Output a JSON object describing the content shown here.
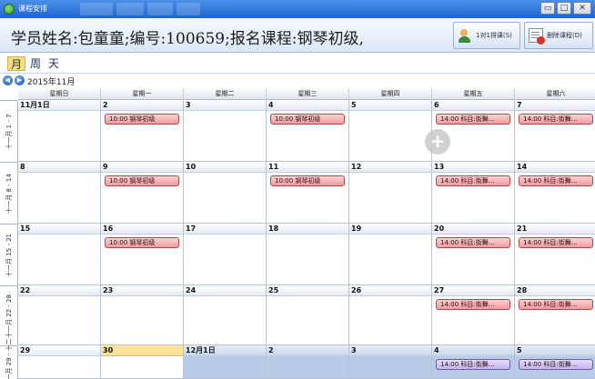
{
  "window": {
    "title": "课程安排",
    "minimize_glyph": "▭",
    "maximize_glyph": "□",
    "close_glyph": "✕"
  },
  "header": {
    "student_info": "学员姓名:包童童;编号:100659;报名课程:钢琴初级,",
    "schedule_button": "1对1排课(S)",
    "delete_button": "删除课程(D)"
  },
  "view_tabs": {
    "month": "月",
    "week": "周",
    "day": "天",
    "active": "month"
  },
  "nav": {
    "prev_glyph": "◀",
    "next_glyph": "▶",
    "current": "2015年11月"
  },
  "weekdays": [
    "星期日",
    "星期一",
    "星期二",
    "星期三",
    "星期四",
    "星期五",
    "星期六"
  ],
  "weeks": [
    {
      "label": "十一月 1 - 7",
      "days": [
        "11月1日",
        "2",
        "3",
        "4",
        "5",
        "6",
        "7"
      ]
    },
    {
      "label": "十一月 8 - 14",
      "days": [
        "8",
        "9",
        "10",
        "11",
        "12",
        "13",
        "14"
      ]
    },
    {
      "label": "十一月 15 - 21",
      "days": [
        "15",
        "16",
        "17",
        "18",
        "19",
        "20",
        "21"
      ]
    },
    {
      "label": "十一月 22 - 28",
      "days": [
        "22",
        "23",
        "24",
        "25",
        "26",
        "27",
        "28"
      ]
    },
    {
      "label": "十一月 29 - 十二",
      "days": [
        "29",
        "30",
        "12月1日",
        "2",
        "3",
        "4",
        "5"
      ]
    }
  ],
  "events": {
    "piano": "10:00 钢琴初级",
    "dance": "14:00 科目:街舞…",
    "dance_alt": "14:00 科目:街舞…"
  },
  "add_glyph": "+",
  "colors": {
    "event_fill": "#ee9c9e",
    "event_alt_fill": "#c4b5ef",
    "today": "#fde49a",
    "other_month": "#b9cbe6"
  }
}
